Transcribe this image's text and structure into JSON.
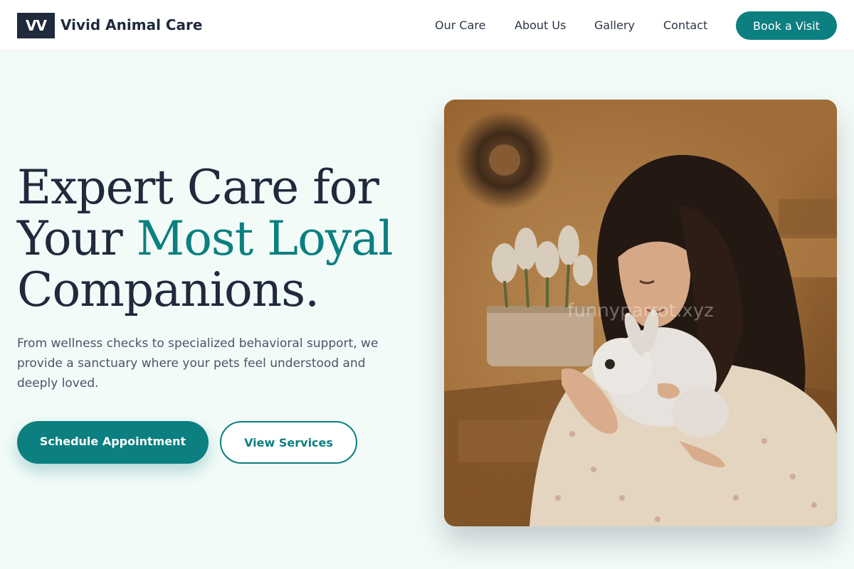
{
  "header": {
    "logo_text": "VV",
    "brand_name": "Vivid Animal Care",
    "nav": [
      {
        "label": "Our Care"
      },
      {
        "label": "About Us"
      },
      {
        "label": "Gallery"
      },
      {
        "label": "Contact"
      }
    ],
    "cta_label": "Book a Visit"
  },
  "hero": {
    "title_line1": "Expert Care for",
    "title_line2_start": "Your ",
    "title_line2_accent": "Most Loyal",
    "title_line3": "Companions.",
    "description": "From wellness checks to specialized behavioral support, we provide a sanctuary where your pets feel understood and deeply loved.",
    "primary_button": "Schedule Appointment",
    "secondary_button": "View Services",
    "image_watermark": "funnyparrot.xyz"
  },
  "colors": {
    "accent": "#0c7f80",
    "dark": "#1f2a3c",
    "background": "#f2fbf8"
  },
  "icons": {
    "logo": "vv-monogram"
  }
}
